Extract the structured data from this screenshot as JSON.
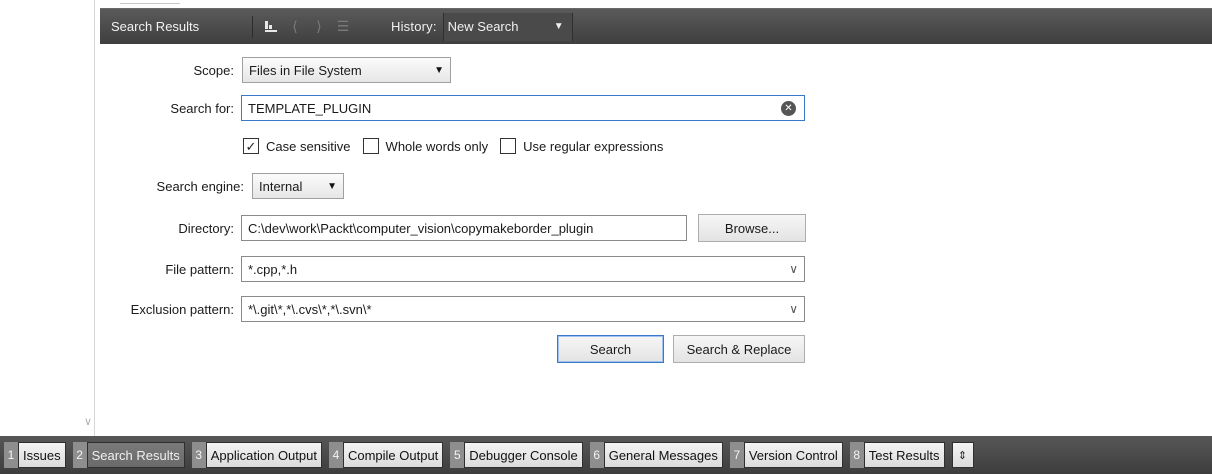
{
  "toolbar": {
    "title": "Search Results",
    "history_label": "History:",
    "history_value": "New Search"
  },
  "form": {
    "scope_label": "Scope:",
    "scope_value": "Files in File System",
    "search_for_label": "Search for:",
    "search_for_value": "TEMPLATE_PLUGIN",
    "options": [
      {
        "label": "Case sensitive",
        "checked": true
      },
      {
        "label": "Whole words only",
        "checked": false
      },
      {
        "label": "Use regular expressions",
        "checked": false
      }
    ],
    "engine_label": "Search engine:",
    "engine_value": "Internal",
    "directory_label": "Directory:",
    "directory_value": "C:\\dev\\work\\Packt\\computer_vision\\copymakeborder_plugin",
    "browse_label": "Browse...",
    "file_pattern_label": "File pattern:",
    "file_pattern_value": "*.cpp,*.h",
    "exclusion_label": "Exclusion pattern:",
    "exclusion_value": "*\\.git\\*,*\\.cvs\\*,*\\.svn\\*",
    "search_button": "Search",
    "search_replace_button": "Search & Replace"
  },
  "output_tabs": [
    {
      "num": "1",
      "label": "Issues",
      "active": false
    },
    {
      "num": "2",
      "label": "Search Results",
      "active": true
    },
    {
      "num": "3",
      "label": "Application Output",
      "active": false
    },
    {
      "num": "4",
      "label": "Compile Output",
      "active": false
    },
    {
      "num": "5",
      "label": "Debugger Console",
      "active": false
    },
    {
      "num": "6",
      "label": "General Messages",
      "active": false
    },
    {
      "num": "7",
      "label": "Version Control",
      "active": false
    },
    {
      "num": "8",
      "label": "Test Results",
      "active": false
    }
  ],
  "colors": {
    "toolbar_bg": "#4a4a4a",
    "focus_border": "#3a78c9",
    "active_tab": "#6f6f6f"
  }
}
